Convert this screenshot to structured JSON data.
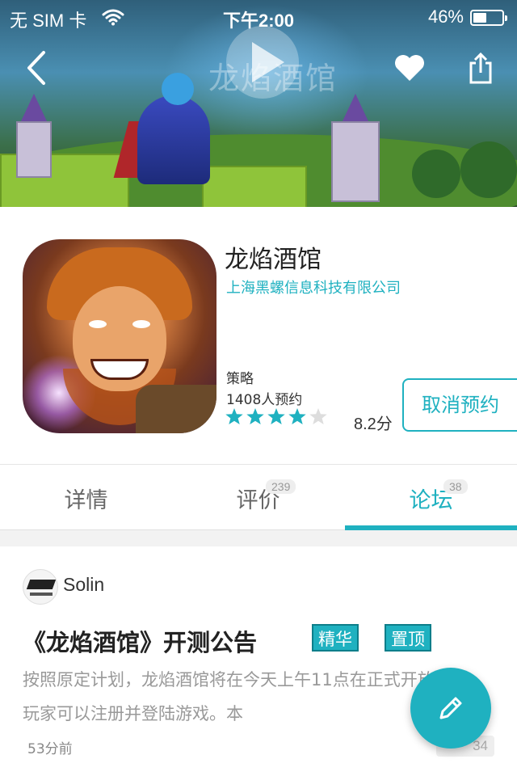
{
  "status_bar": {
    "carrier": "无 SIM 卡",
    "time": "下午2:00",
    "battery_text": "46%",
    "battery_level": 0.46
  },
  "banner": {
    "watermark": "龙焰酒馆"
  },
  "nav": {
    "back_icon": "back-chevron-icon",
    "favorite_icon": "heart-icon",
    "share_icon": "share-icon"
  },
  "app": {
    "name": "龙焰酒馆",
    "developer": "上海黑螺信息科技有限公司",
    "category": "策略",
    "reservations": "1408人预约",
    "rating_stars": 4,
    "rating_max": 5,
    "score": "8.2分",
    "cancel_button": "取消预约"
  },
  "tabs": [
    {
      "label": "详情",
      "badge": ""
    },
    {
      "label": "评价",
      "badge": "239"
    },
    {
      "label": "论坛",
      "badge": "38"
    }
  ],
  "active_tab": 2,
  "post": {
    "author": "Solin",
    "title": "《龙焰酒馆》开测公告",
    "tags": [
      "精华",
      "置顶"
    ],
    "excerpt": "按照原定计划，龙焰酒馆将在今天上午11点在正式开放下载，玩家可以注册并登陆游戏。本",
    "time": "53分前",
    "comments": "34"
  },
  "colors": {
    "accent": "#1fb1c0",
    "star_empty": "#dddddd"
  }
}
